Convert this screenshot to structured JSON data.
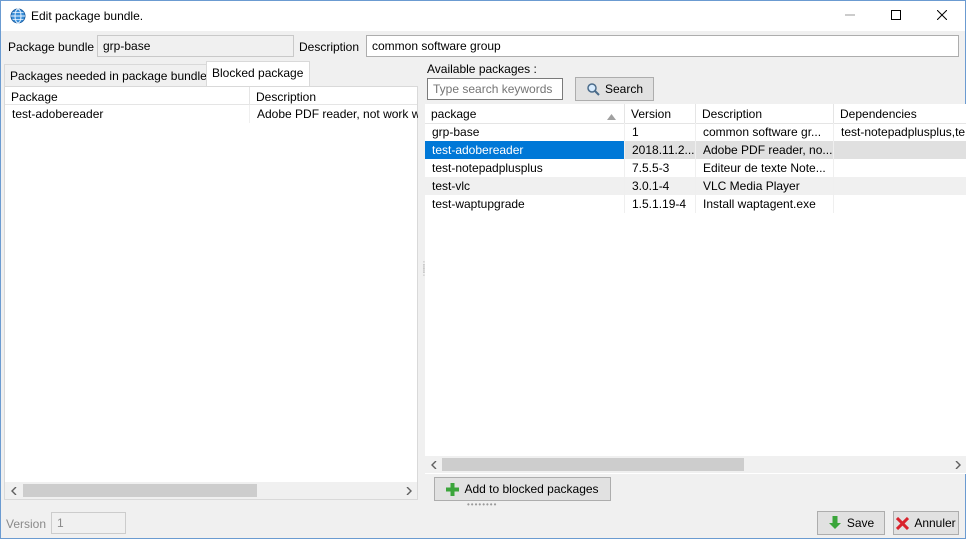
{
  "window": {
    "title": "Edit package bundle.",
    "minimize_icon": "minimize-icon",
    "maximize_icon": "maximize-icon",
    "close_icon": "close-icon"
  },
  "top_fields": {
    "bundle_label": "Package bundle",
    "bundle_value": "grp-base",
    "description_label": "Description",
    "description_value": "common software group"
  },
  "tabs": [
    {
      "label": "Packages needed in package bundle",
      "active": false
    },
    {
      "label": "Blocked package",
      "active": true
    }
  ],
  "left_grid": {
    "columns": [
      "Package",
      "Description"
    ],
    "rows": [
      [
        "test-adobereader",
        "Adobe PDF reader, not work w"
      ]
    ]
  },
  "available": {
    "label": "Available packages :",
    "search_placeholder": "Type search keywords",
    "search_button": "Search",
    "columns": [
      "package",
      "Version",
      "Description",
      "Dependencies"
    ],
    "rows": [
      [
        "grp-base",
        "1",
        "common software gr...",
        "test-notepadplusplus,te"
      ],
      [
        "test-adobereader",
        "2018.11.2...",
        "Adobe PDF reader, no...",
        ""
      ],
      [
        "test-notepadplusplus",
        "7.5.5-3",
        "Editeur de texte Note...",
        ""
      ],
      [
        "test-vlc",
        "3.0.1-4",
        "VLC Media Player",
        ""
      ],
      [
        "test-waptupgrade",
        "1.5.1.19-4",
        "Install waptagent.exe",
        ""
      ]
    ],
    "selected_row": 1
  },
  "buttons": {
    "add_blocked": "Add to blocked packages",
    "save": "Save",
    "cancel": "Annuler"
  },
  "footer": {
    "version_label": "Version",
    "version_value": "1"
  },
  "colors": {
    "selection": "#0078d7",
    "plus_green": "#3ba53b",
    "cancel_red": "#d9232d"
  }
}
